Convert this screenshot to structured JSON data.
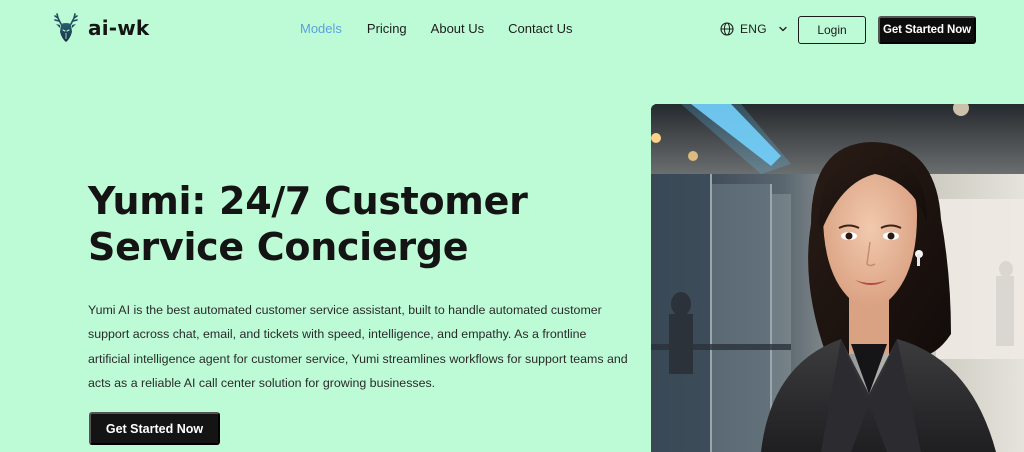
{
  "brand": {
    "name": "ai-wk",
    "logo_icon": "deer-head-icon"
  },
  "nav": {
    "items": [
      {
        "label": "Models",
        "active": true
      },
      {
        "label": "Pricing",
        "active": false
      },
      {
        "label": "About Us",
        "active": false
      },
      {
        "label": "Contact Us",
        "active": false
      }
    ],
    "active_color": "#5aa1e0"
  },
  "language": {
    "label": "ENG",
    "icon": "globe-icon"
  },
  "header": {
    "login_label": "Login",
    "cta_label": "Get Started Now"
  },
  "hero": {
    "title": "Yumi: 24/7 Customer Service Concierge",
    "description": "Yumi AI is the best automated customer service assistant, built to handle automated customer support across chat, email, and tickets with speed, intelligence, and empathy. As a frontline artificial intelligence agent for customer service, Yumi streamlines workflows for support teams and acts as a reliable AI call center solution for growing businesses.",
    "cta_label": "Get Started Now",
    "image": "photo of a smiling woman in a dark blazer wearing an earpiece in a modern office"
  },
  "colors": {
    "background": "#bdfbd6",
    "button_dark": "#141414",
    "text": "#161616"
  }
}
